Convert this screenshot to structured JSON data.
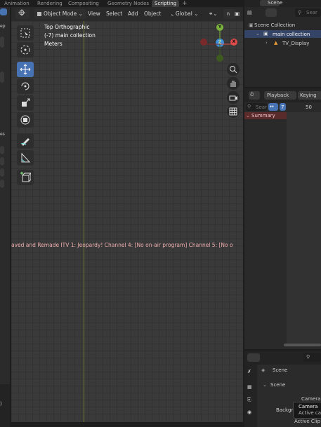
{
  "workspace_tabs": [
    "Animation",
    "Rendering",
    "Compositing",
    "Geometry Nodes",
    "Scripting"
  ],
  "active_tab": "Scripting",
  "add_tab_glyph": "+",
  "viewport": {
    "mode": "Object Mode",
    "menus": [
      "View",
      "Select",
      "Add",
      "Object"
    ],
    "orientation": "Global",
    "view_name": "Top Orthographic",
    "collection_info": "(-7) main collection",
    "units": "Meters",
    "ticker_text": "aved and Remade    ITV 1: Jeopardy!    Channel 4: [No on-air program]    Channel 5: [No o"
  },
  "gizmo": {
    "x": "X",
    "y": "Y",
    "z": "Z"
  },
  "left_strip": {
    "label_top": "ep",
    "label_mid": "es"
  },
  "outliner": {
    "header": "Scene",
    "search_placeholder": "Sear",
    "items": [
      "Scene Collection",
      "main collection",
      "TV_Display"
    ]
  },
  "timeline": {
    "playback": "Playback",
    "keying": "Keying",
    "search_placeholder": "Sear",
    "current_frame": "7",
    "frame_mark": "50",
    "summary": "Summary"
  },
  "properties": {
    "header": "Scene",
    "section": "Scene",
    "camera_label": "Camera",
    "background_label": "Backgro",
    "tooltip_line1": "Camera",
    "tooltip_line2": "Active ca",
    "active_clip": "Active Clip"
  },
  "colors": {
    "accent": "#4772b3",
    "x_axis": "#e04b4b",
    "y_axis": "#7ab23c",
    "z_axis": "#3b8fd9",
    "summary_bg": "#5a2b2b"
  }
}
